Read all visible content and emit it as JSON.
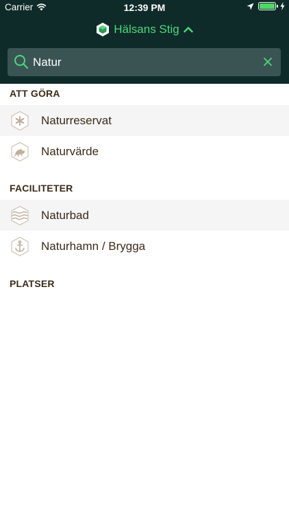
{
  "status_bar": {
    "carrier": "Carrier",
    "time": "12:39 PM",
    "battery_level": 1.0
  },
  "header": {
    "title": "Hälsans Stig",
    "logo_icon": "hexagon-logo-icon",
    "expand_icon": "chevron-up-icon",
    "accent_color": "#4dd87a",
    "background_color": "#0f2b29"
  },
  "search": {
    "value": "Natur",
    "icon": "search-icon",
    "clear_icon": "close-icon"
  },
  "sections": [
    {
      "title": "ATT GÖRA",
      "items": [
        {
          "label": "Naturreservat",
          "icon": "asterisk-hex-icon"
        },
        {
          "label": "Naturvärde",
          "icon": "frog-hex-icon"
        }
      ]
    },
    {
      "title": "FACILITETER",
      "items": [
        {
          "label": "Naturbad",
          "icon": "waves-hex-icon"
        },
        {
          "label": "Naturhamn / Brygga",
          "icon": "anchor-hex-icon"
        }
      ]
    },
    {
      "title": "PLATSER",
      "items": []
    }
  ]
}
